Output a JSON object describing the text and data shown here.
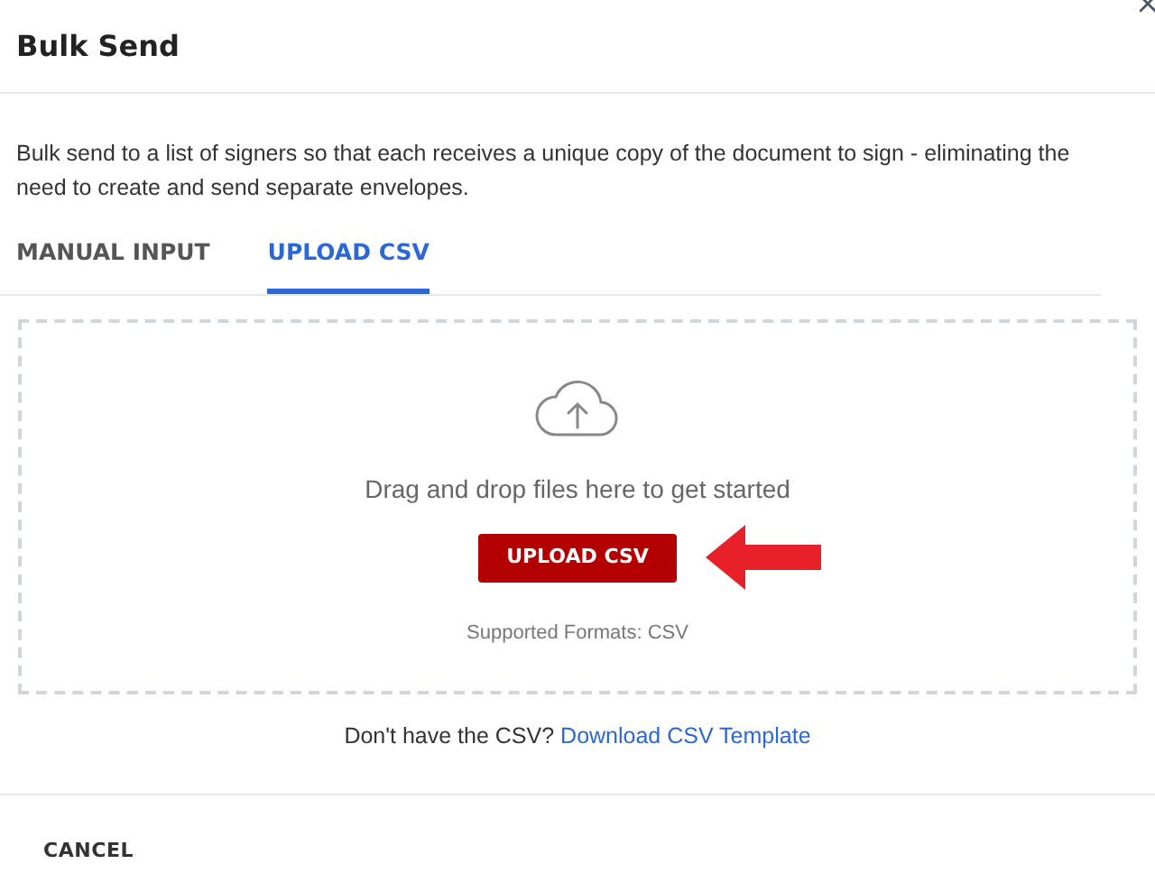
{
  "dialog": {
    "title": "Bulk Send",
    "description": "Bulk send to a list of signers so that each receives a unique copy of the document to sign - eliminating the need to create and send separate envelopes."
  },
  "tabs": [
    {
      "label": "MANUAL INPUT",
      "selected": false
    },
    {
      "label": "UPLOAD CSV",
      "selected": true
    }
  ],
  "dropzone": {
    "prompt": "Drag and drop files here to get started",
    "button": "UPLOAD CSV",
    "formats": "Supported Formats: CSV"
  },
  "template": {
    "question": "Don't have the CSV?",
    "link": "Download CSV Template"
  },
  "footer": {
    "cancel": "CANCEL"
  }
}
